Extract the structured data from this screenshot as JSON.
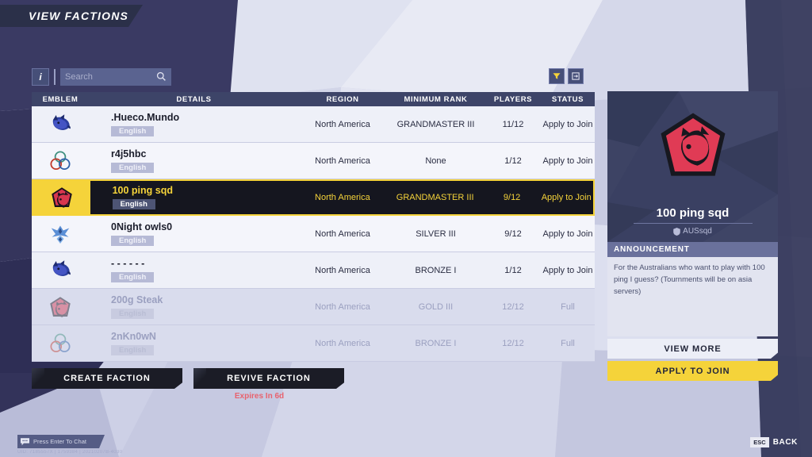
{
  "header": {
    "title": "VIEW FACTIONS"
  },
  "toolbar": {
    "info_icon": "info-icon",
    "search_placeholder": "Search",
    "search_value": "",
    "search_icon": "search-icon",
    "filter_icon": "filter-funnel-icon",
    "refresh_icon": "refresh-swap-icon"
  },
  "table": {
    "columns": [
      "EMBLEM",
      "DETAILS",
      "REGION",
      "MINIMUM RANK",
      "PLAYERS",
      "STATUS"
    ],
    "rows": [
      {
        "emblem": "wolf-blue",
        "name": ".Hueco.Mundo",
        "language": "English",
        "region": "North America",
        "rank": "GRANDMASTER III",
        "players": "11/12",
        "status": "Apply to Join",
        "state": "normal"
      },
      {
        "emblem": "trefoil",
        "name": "r4j5hbc",
        "language": "English",
        "region": "North America",
        "rank": "None",
        "players": "1/12",
        "status": "Apply to Join",
        "state": "normal"
      },
      {
        "emblem": "boar-red",
        "name": "100 ping sqd",
        "language": "English",
        "region": "North America",
        "rank": "GRANDMASTER III",
        "players": "9/12",
        "status": "Apply to Join",
        "state": "selected"
      },
      {
        "emblem": "phoenix-blue",
        "name": "0Night owls0",
        "language": "English",
        "region": "North America",
        "rank": "SILVER III",
        "players": "9/12",
        "status": "Apply to Join",
        "state": "normal"
      },
      {
        "emblem": "wolf-blue",
        "name": "- - - - - -",
        "language": "English",
        "region": "North America",
        "rank": "BRONZE I",
        "players": "1/12",
        "status": "Apply to Join",
        "state": "normal"
      },
      {
        "emblem": "boar-red",
        "name": "200g Steak",
        "language": "English",
        "region": "North America",
        "rank": "GOLD III",
        "players": "12/12",
        "status": "Full",
        "state": "dim"
      },
      {
        "emblem": "trefoil",
        "name": "2nKn0wN",
        "language": "English",
        "region": "North America",
        "rank": "BRONZE I",
        "players": "12/12",
        "status": "Full",
        "state": "dim"
      }
    ]
  },
  "actions": {
    "create_faction": "CREATE FACTION",
    "revive_faction": "REVIVE FACTION",
    "expires_note": "Expires In 6d"
  },
  "panel": {
    "faction_name": "100 ping sqd",
    "faction_tag": "AUSsqd",
    "tag_icon": "shield-icon",
    "emblem": "boar-red",
    "announcement_header": "ANNOUNCEMENT",
    "announcement_body": "For the Australians who want to play with 100 ping I guess? (Tournments will be on asia servers)",
    "view_more": "VIEW MORE",
    "apply_to_join": "APPLY TO JOIN"
  },
  "footer": {
    "chat_hint": "Press Enter To Chat",
    "chat_icon": "chat-bubble-icon",
    "build_info": "UID: 7185557X | 1759384 | 20210207B-4030",
    "esc_key": "ESC",
    "back_label": "BACK"
  },
  "colors": {
    "accent_yellow": "#f5d33a",
    "dark_navy": "#2b3049",
    "panel_blue": "#383e5e",
    "expire_red": "#e8626e"
  }
}
